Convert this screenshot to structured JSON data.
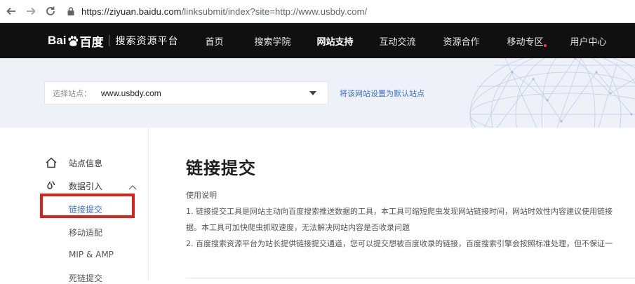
{
  "browser": {
    "url_domain": "https://ziyuan.baidu.com",
    "url_path": "/linksubmit/index?site=http://www.usbdy.com/"
  },
  "header": {
    "logo_text": "Bai",
    "logo_text2": "百度",
    "platform_name": "搜索资源平台",
    "nav": [
      {
        "label": "首页",
        "active": false
      },
      {
        "label": "搜索学院",
        "active": false
      },
      {
        "label": "网站支持",
        "active": true
      },
      {
        "label": "互动交流",
        "active": false
      },
      {
        "label": "资源合作",
        "active": false
      },
      {
        "label": "移动专区",
        "active": false,
        "dot": true
      },
      {
        "label": "用户中心",
        "active": false
      }
    ]
  },
  "banner": {
    "select_label": "选择站点：",
    "select_value": "www.usbdy.com",
    "default_link": "将该网站设置为默认站点"
  },
  "sidebar": {
    "items": [
      {
        "label": "站点信息",
        "icon": "home-icon"
      },
      {
        "label": "数据引入",
        "icon": "data-import-icon",
        "expanded": true
      }
    ],
    "sub_items": [
      {
        "label": "链接提交",
        "active": true
      },
      {
        "label": "移动适配",
        "active": false
      },
      {
        "label": "MIP & AMP",
        "active": false
      },
      {
        "label": "死链提交",
        "active": false
      }
    ]
  },
  "main": {
    "title": "链接提交",
    "desc_heading": "使用说明",
    "desc_lines": [
      "1. 链接提交工具是网站主动向百度搜索推送数据的工具，本工具可缩短爬虫发现网站链接时间，网站时效性内容建议使用链接",
      "据。本工具可加快爬虫抓取速度，无法解决网站内容是否收录问题",
      "2. 百度搜索资源平台为站长提供链接提交通道，您可以提交想被百度收录的链接，百度搜索引擎会按照标准处理，但不保证一"
    ]
  },
  "colors": {
    "header_bg": "#101010",
    "banner_bg": "#eef1f7",
    "link_blue": "#3d6fd0",
    "highlight_red": "#d9231d"
  }
}
